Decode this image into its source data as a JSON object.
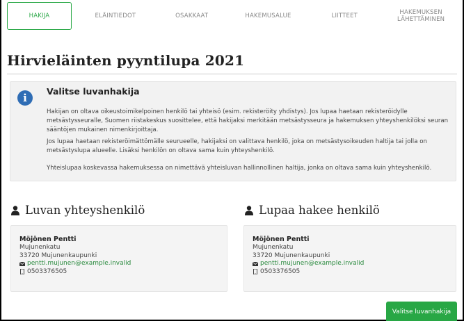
{
  "tabs": [
    {
      "label": "HAKIJA",
      "active": true
    },
    {
      "label": "ELÄINTIEDOT"
    },
    {
      "label": "OSAKKAAT"
    },
    {
      "label": "HAKEMUSALUE"
    },
    {
      "label": "LIITTEET"
    },
    {
      "label": "HAKEMUKSEN LÄHETTÄMINEN"
    }
  ],
  "page_title": "Hirvieläinten pyyntilupa 2021",
  "info": {
    "icon": "info-icon",
    "heading": "Valitse luvanhakija",
    "paragraphs": [
      "Hakijan on oltava oikeustoimikelpoinen henkilö tai yhteisö (esim. rekisteröity yhdistys). Jos lupaa haetaan rekisteröidylle metsästysseuralle, Suomen riistakeskus suosittelee, että hakijaksi merkitään metsästysseura ja hakemuksen yhteyshenkilöksi seuran sääntöjen mukainen nimenkirjoittaja.",
      "Jos lupaa haetaan rekisteröimättömälle seurueelle, hakijaksi on valittava henkilö, joka on metsästysoikeuden haltija tai jolla on metsästyslupa alueelle. Lisäksi henkilön on oltava sama kuin yhteyshenkilö.",
      "Yhteislupaa koskevassa hakemuksessa on nimettävä yhteisluvan hallinnollinen haltija, jonka on oltava sama kuin yhteyshenkilö."
    ]
  },
  "contact_person": {
    "title": "Luvan yhteyshenkilö",
    "name": "Möjönen Pentti",
    "street": "Mujunenkatu",
    "city": "33720 Mujunenkaupunki",
    "email": "pentti.mujunen@example.invalid",
    "phone": "0503376505"
  },
  "applicant_person": {
    "title": "Lupaa hakee henkilö",
    "name": "Möjönen Pentti",
    "street": "Mujunenkatu",
    "city": "33720 Mujunenkaupunki",
    "email": "pentti.mujunen@example.invalid",
    "phone": "0503376505"
  },
  "choose_button_label": "Valitse luvanhakija",
  "colors": {
    "accent": "#28a745",
    "info": "#2f6db5"
  }
}
